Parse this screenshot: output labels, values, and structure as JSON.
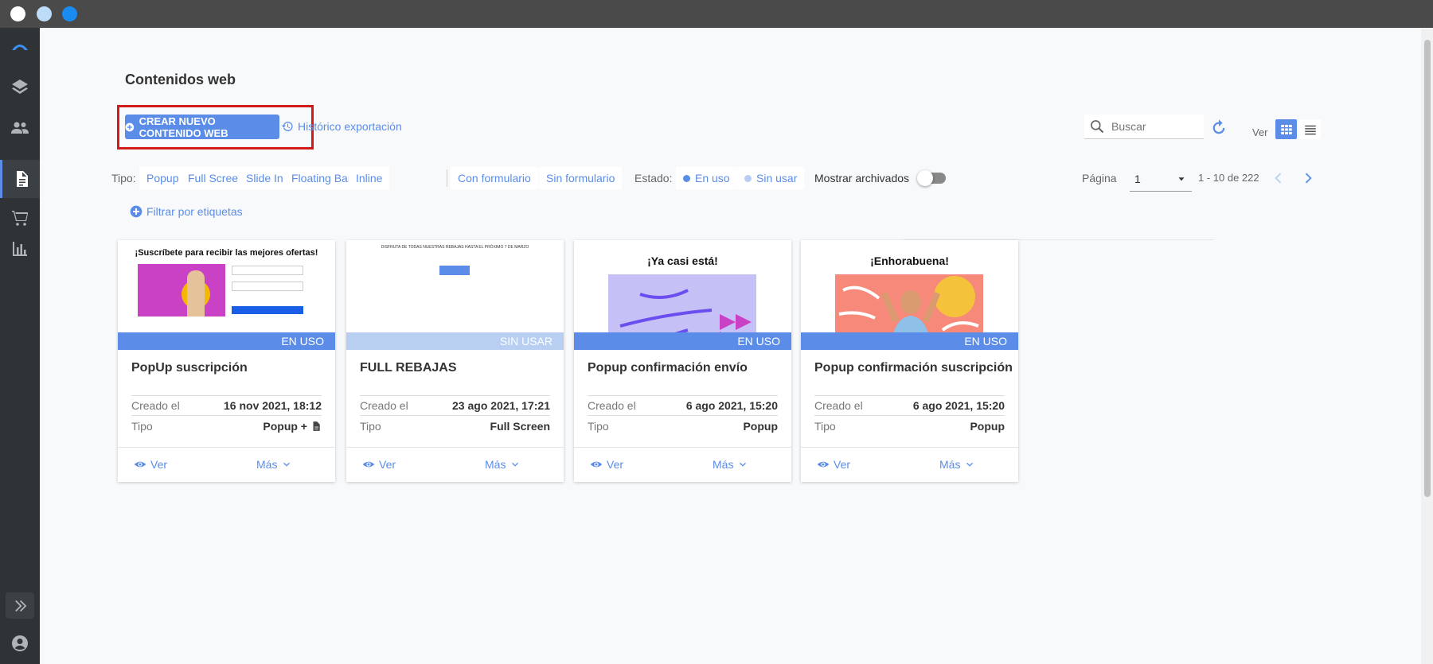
{
  "window": {
    "dot_colors": [
      "#ffffff",
      "#bcdcf7",
      "#1a8bf0"
    ]
  },
  "sidebar": {
    "items": [
      {
        "icon": "logo-icon"
      },
      {
        "icon": "layers-icon"
      },
      {
        "icon": "people-icon"
      },
      {
        "icon": "flow-icon"
      },
      {
        "icon": "document-icon",
        "active": true
      },
      {
        "icon": "cart-icon"
      },
      {
        "icon": "chart-icon"
      }
    ],
    "expand_icon": "double-chevron-right-icon",
    "account_icon": "account-circle-icon"
  },
  "header": {
    "title": "Contenidos web",
    "create_button": "CREAR NUEVO CONTENIDO WEB",
    "history_link": "Histórico exportación",
    "search_placeholder": "Buscar",
    "view_label": "Ver"
  },
  "filters": {
    "tipo_label": "Tipo:",
    "tipo_options": [
      "Popup",
      "Full Screen",
      "Slide In",
      "Floating Bar",
      "Inline"
    ],
    "form_options": [
      "Con formulario",
      "Sin formulario"
    ],
    "estado_label": "Estado:",
    "estado_en_uso": "En uso",
    "estado_sin_usar": "Sin usar",
    "archived_label": "Mostrar archivados",
    "tags_link": "Filtrar por etiquetas"
  },
  "pagination": {
    "label": "Página",
    "current": "1",
    "range": "1 - 10 de 222"
  },
  "cards": [
    {
      "status": "EN USO",
      "status_color": "#5b8de8",
      "title": "PopUp suscripción",
      "created_label": "Creado el",
      "created": "16 nov 2021, 18:12",
      "type_label": "Tipo",
      "type": "Popup +",
      "preview_heading": "¡Suscríbete para recibir las mejores ofertas!",
      "view": "Ver",
      "more": "Más"
    },
    {
      "status": "SIN USAR",
      "status_color": "#b8cff2",
      "title": "FULL REBAJAS",
      "created_label": "Creado el",
      "created": "23 ago 2021, 17:21",
      "type_label": "Tipo",
      "type": "Full Screen",
      "preview_heading": "DISFRUTA DE TODAS NUESTRAS REBAJAS HASTA EL PRÓXIMO 7 DE MARZO",
      "view": "Ver",
      "more": "Más"
    },
    {
      "status": "EN USO",
      "status_color": "#5b8de8",
      "title": "Popup confirmación envío",
      "created_label": "Creado el",
      "created": "6 ago 2021, 15:20",
      "type_label": "Tipo",
      "type": "Popup",
      "preview_heading": "¡Ya casi está!",
      "view": "Ver",
      "more": "Más"
    },
    {
      "status": "EN USO",
      "status_color": "#5b8de8",
      "title": "Popup confirmación suscripción",
      "created_label": "Creado el",
      "created": "6 ago 2021, 15:20",
      "type_label": "Tipo",
      "type": "Popup",
      "preview_heading": "¡Enhorabuena!",
      "view": "Ver",
      "more": "Más"
    }
  ]
}
